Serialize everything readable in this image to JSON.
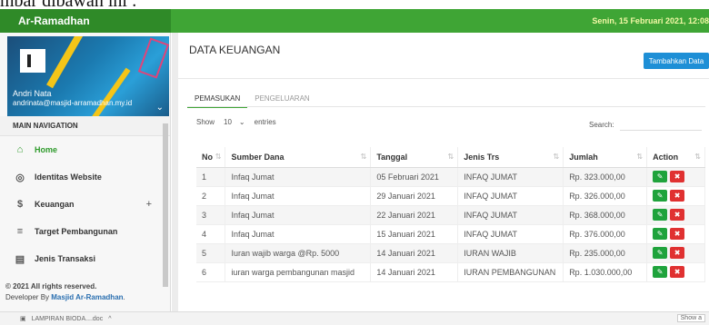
{
  "caption": "mbar dibawah ini :",
  "app": {
    "brand": "Ar-Ramadhan",
    "date": "Senin, 15 Februari 2021, 12:08"
  },
  "user": {
    "name": "Andri Nata",
    "email": "andrinata@masjid-arramadhan.my.id"
  },
  "sidebar": {
    "header": "MAIN NAVIGATION",
    "items": [
      {
        "label": "Home",
        "icon": "home-icon"
      },
      {
        "label": "Identitas Website",
        "icon": "globe-icon"
      },
      {
        "label": "Keuangan",
        "icon": "dollar-icon",
        "expand": "+"
      },
      {
        "label": "Target Pembangunan",
        "icon": "list-check-icon"
      },
      {
        "label": "Jenis Transaksi",
        "icon": "list-icon"
      }
    ],
    "footer_line1": "© 2021 All rights reserved.",
    "footer_prefix": "Developer By ",
    "footer_brand": "Masjid Ar-Ramadhan",
    "footer_suffix": "."
  },
  "main": {
    "title": "DATA KEUANGAN",
    "add_button": "Tambahkan Data",
    "tabs": [
      "PEMASUKAN",
      "PENGELUARAN"
    ],
    "show_label": "Show",
    "show_value": "10",
    "entries_label": "entries",
    "search_label": "Search:",
    "columns": [
      "No",
      "Sumber Dana",
      "Tanggal",
      "Jenis Trs",
      "Jumlah",
      "Action"
    ],
    "rows": [
      {
        "no": "1",
        "sumber": "Infaq Jumat",
        "tanggal": "05 Februari 2021",
        "jenis": "INFAQ JUMAT",
        "jumlah": "Rp. 323.000,00"
      },
      {
        "no": "2",
        "sumber": "Infaq Jumat",
        "tanggal": "29 Januari 2021",
        "jenis": "INFAQ JUMAT",
        "jumlah": "Rp. 326.000,00"
      },
      {
        "no": "3",
        "sumber": "Infaq Jumat",
        "tanggal": "22 Januari 2021",
        "jenis": "INFAQ JUMAT",
        "jumlah": "Rp. 368.000,00"
      },
      {
        "no": "4",
        "sumber": "Infaq Jumat",
        "tanggal": "15 Januari 2021",
        "jenis": "INFAQ JUMAT",
        "jumlah": "Rp. 376.000,00"
      },
      {
        "no": "5",
        "sumber": "Iuran wajib warga @Rp. 5000",
        "tanggal": "14 Januari 2021",
        "jenis": "IURAN WAJIB",
        "jumlah": "Rp. 235.000,00"
      },
      {
        "no": "6",
        "sumber": "iuran warga pembangunan masjid",
        "tanggal": "14 Januari 2021",
        "jenis": "IURAN PEMBANGUNAN",
        "jumlah": "Rp. 1.030.000,00"
      }
    ]
  },
  "downloads": {
    "file": "LAMPIRAN BIODA....doc",
    "show_all": "Show a"
  },
  "colors": {
    "topbar": "#3fa535",
    "accent_green": "#2e9a2b",
    "add_button": "#1e8fd6",
    "edit": "#1fa33c",
    "delete": "#e03131"
  }
}
